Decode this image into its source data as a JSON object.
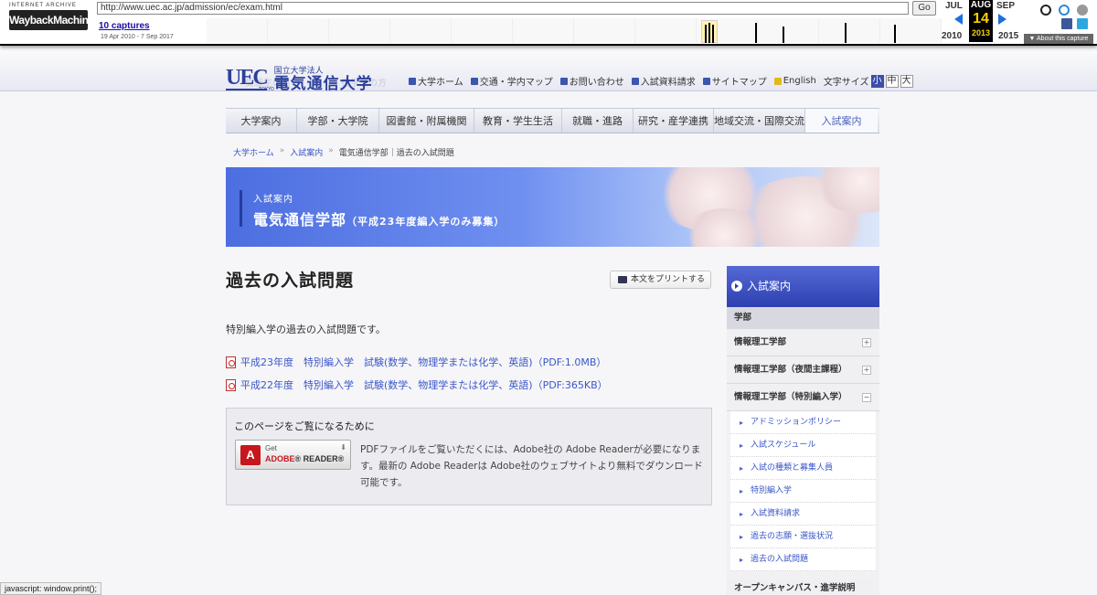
{
  "wayback": {
    "logo_top": "INTERNET ARCHIVE",
    "logo_main": "WaybackMachine",
    "url": "http://www.uec.ac.jp/admission/ec/exam.html",
    "go": "Go",
    "captures": "10 captures",
    "range": "19 Apr 2010 - 7 Sep 2017",
    "prev_month": "JUL",
    "cur_month": "AUG",
    "cur_day": "14",
    "cur_year": "2013",
    "next_month": "SEP",
    "prev_year": "2010",
    "next_year": "2015",
    "about": "▼ About this capture"
  },
  "ghost_nav": [
    "受験生の方",
    "在学生の方"
  ],
  "logo": {
    "mark": "UEC",
    "tokyo": "TOKYO",
    "line1": "国立大学法人",
    "line2": "電気通信大学"
  },
  "utility": {
    "items": [
      "大学ホーム",
      "交通・学内マップ",
      "お問い合わせ",
      "入試資料請求",
      "サイトマップ",
      "English"
    ],
    "fontsize_label": "文字サイズ",
    "sizes": [
      "小",
      "中",
      "大"
    ]
  },
  "gnav": [
    "大学案内",
    "学部・大学院",
    "図書館・附属機関",
    "教育・学生生活",
    "就職・進路",
    "研究・産学連携",
    "地域交流・国際交流",
    "入試案内"
  ],
  "breadcrumb": {
    "home": "大学ホーム",
    "admission": "入試案内",
    "current": "電気通信学部｜過去の入試問題"
  },
  "banner": {
    "label": "入試案内",
    "title": "電気通信学部",
    "note": "（平成23年度編入学のみ募集）"
  },
  "page": {
    "title": "過去の入試問題",
    "print": "本文をプリントする",
    "intro": "特別編入学の過去の入試問題です。",
    "links": [
      "平成23年度　特別編入学　試験(数学、物理学または化学、英語)（PDF:1.0MB）",
      "平成22年度　特別編入学　試験(数学、物理学または化学、英語)（PDF:365KB）"
    ]
  },
  "reader": {
    "title": "このページをご覧になるために",
    "get": "Get",
    "adobe": "ADOBE",
    "product": "READER",
    "desc": "PDFファイルをご覧いただくには、Adobe社の Adobe Readerが必要になります。最新の Adobe Readerは Adobe社のウェブサイトより無料でダウンロード可能です。"
  },
  "sidebar": {
    "head": "入試案内",
    "category": "学部",
    "items": [
      {
        "label": "情報理工学部",
        "toggle": "+"
      },
      {
        "label": "情報理工学部（夜間主課程）",
        "toggle": "+"
      },
      {
        "label": "情報理工学部（特別編入学）",
        "toggle": "−"
      }
    ],
    "subitems": [
      "アドミッションポリシー",
      "入試スケジュール",
      "入試の種類と募集人員",
      "特別編入学",
      "入試資料請求",
      "過去の志願・選抜状況",
      "過去の入試問題"
    ],
    "next": "オープンキャンパス・進学説明"
  },
  "status": "javascript: window.print();"
}
